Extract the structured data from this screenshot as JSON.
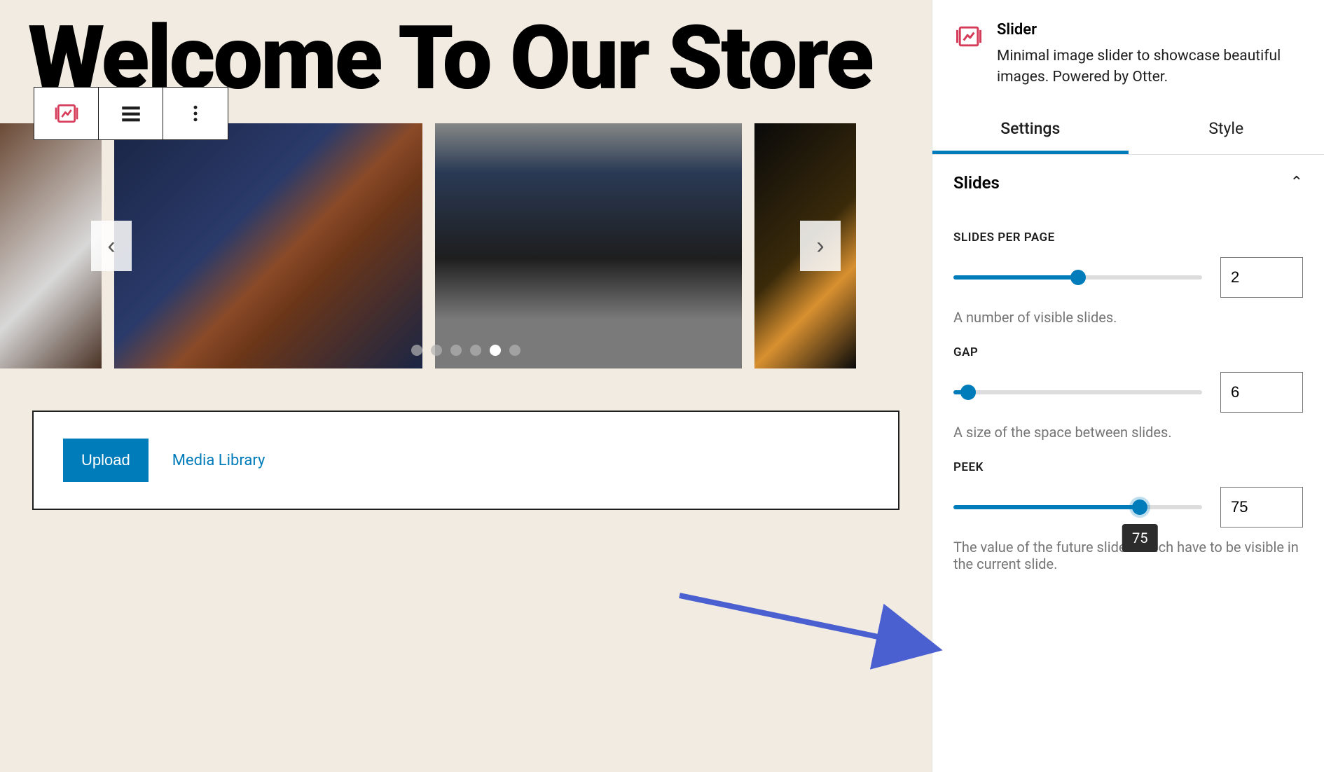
{
  "editor": {
    "page_title": "Welcome To Our Store",
    "toolbar": {
      "block_icon": "slider-icon",
      "align_icon": "align-icon",
      "more_icon": "more-vertical-icon"
    },
    "slider": {
      "nav_prev": "‹",
      "nav_next": "›",
      "dot_count": 6,
      "active_dot_index": 4
    },
    "media_box": {
      "upload_label": "Upload",
      "library_label": "Media Library"
    }
  },
  "sidebar": {
    "block_name": "Slider",
    "block_desc": "Minimal image slider to showcase beautiful images. Powered by Otter.",
    "tabs": {
      "settings": "Settings",
      "style": "Style",
      "active": "settings"
    },
    "section_title": "Slides",
    "controls": {
      "slides_per_page": {
        "label": "Slides Per Page",
        "value": "2",
        "fill_pct": 50,
        "help": "A number of visible slides."
      },
      "gap": {
        "label": "Gap",
        "value": "6",
        "fill_pct": 6,
        "help": "A size of the space between slides."
      },
      "peek": {
        "label": "Peek",
        "value": "75",
        "fill_pct": 75,
        "tooltip": "75",
        "help": "The value of the future slides which have to be visible in the current slide."
      }
    }
  }
}
